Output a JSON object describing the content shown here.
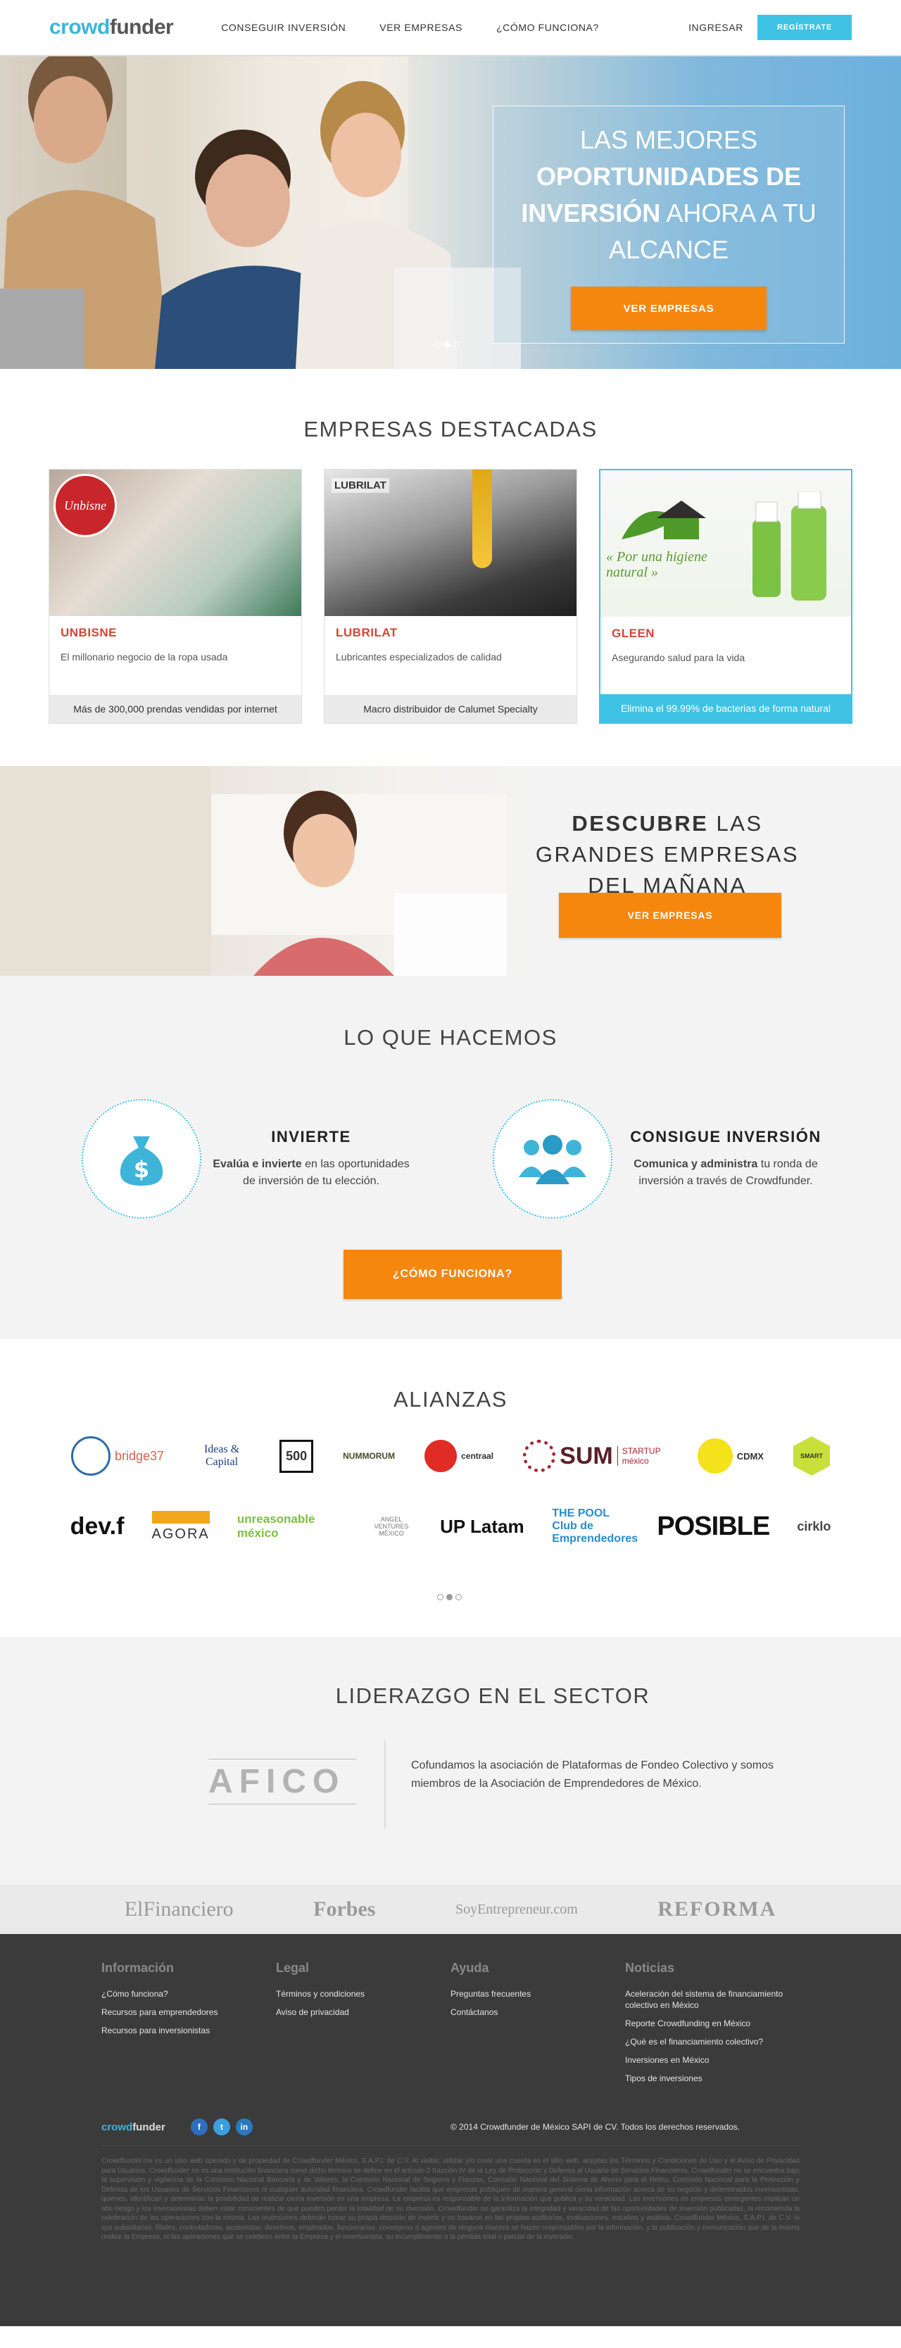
{
  "brand": {
    "logo_part1": "crowd",
    "logo_part2": "funder"
  },
  "nav": {
    "items": [
      "CONSEGUIR INVERSIÓN",
      "VER EMPRESAS",
      "¿CÓMO FUNCIONA?"
    ],
    "login": "INGRESAR",
    "register": "REGÍSTRATE"
  },
  "hero": {
    "title_line1": "LAS MEJORES",
    "title_bold": "OPORTUNIDADES DE INVERSIÓN",
    "title_rest": "AHORA A TU ALCANCE",
    "cta": "VER EMPRESAS",
    "slides": 3,
    "active_slide": 1
  },
  "featured": {
    "title": "EMPRESAS DESTACADAS",
    "cards": [
      {
        "name": "UNBISNE",
        "desc": "El millonario negocio de la ropa usada",
        "foot": "Más de 300,000 prendas vendidas por internet",
        "img_label": "Unbisne"
      },
      {
        "name": "LUBRILAT",
        "desc": "Lubricantes especializados de calidad",
        "foot": "Macro distribuidor de Calumet Specialty",
        "img_label": "LUBRILAT"
      },
      {
        "name": "GLEEN",
        "desc": "Asegurando salud para la vida",
        "foot": "Elimina el 99.99% de bacterias de forma natural",
        "img_label": "« Por una higiene natural »"
      }
    ]
  },
  "discover": {
    "bold": "DESCUBRE",
    "rest": "LAS GRANDES EMPRESAS DEL MAÑANA",
    "cta": "VER EMPRESAS"
  },
  "what": {
    "title": "LO QUE HACEMOS",
    "invest": {
      "title": "INVIERTE",
      "bold": "Evalúa e invierte",
      "text": "en las oportunidades de inversión de tu elección."
    },
    "raise": {
      "title": "CONSIGUE INVERSIÓN",
      "bold": "Comunica y administra",
      "text": "tu ronda de inversión a través de Crowdfunder."
    },
    "cta": "¿CÓMO FUNCIONA?"
  },
  "alliances": {
    "title": "ALIANZAS",
    "row1": [
      "bridge37",
      "Ideas & Capital",
      "500",
      "NUMMORUM",
      "centraal",
      "SUM",
      "STARTUP méxico",
      "CDMX",
      "SMART"
    ],
    "row2": [
      "dev.f",
      "AGORA",
      "unreasonable méxico",
      "ANGEL VENTURES MÉXICO",
      "UP Latam",
      "THE POOL Club de Emprendedores",
      "POSIBLE",
      "cirklo"
    ]
  },
  "leader": {
    "title": "LIDERAZGO EN EL SECTOR",
    "logo": "AFICO",
    "text": "Cofundamos la asociación de Plataformas de Fondeo Colectivo y somos miembros de la Asociación de Emprendedores de México."
  },
  "press": [
    "ElFinanciero",
    "Forbes",
    "SoyEntrepreneur.com",
    "REFORMA"
  ],
  "footer": {
    "cols": [
      {
        "title": "Información",
        "links": [
          "¿Cómo funciona?",
          "Recursos para emprendedores",
          "Recursos para inversionistas"
        ]
      },
      {
        "title": "Legal",
        "links": [
          "Términos y condiciones",
          "Aviso de privacidad"
        ]
      },
      {
        "title": "Ayuda",
        "links": [
          "Preguntas frecuentes",
          "Contáctanos"
        ]
      },
      {
        "title": "Noticias",
        "links": [
          "Aceleración del sistema de financiamiento colectivo en México",
          "Reporte Crowdfunding en México",
          "¿Qué es el financiamiento colectivo?",
          "Inversiones en México",
          "Tipos de inversiones"
        ]
      }
    ],
    "copyright": "© 2014 Crowdfunder de México SAPI de CV. Todos los derechos reservados.",
    "legal": "Crowdfunder.mx es un sitio web operado y de propiedad de Crowdfunder México, S.A.P.I. de C.V. Al visitar, utilizar y/o crear una cuenta en el sitio web, aceptas los Términos y Condiciones de Uso y el Aviso de Privacidad para Usuarios. Crowdfunder no es una institución financiera como dicho término se define en el artículo 2 fracción IV de la Ley de Protección y Defensa al Usuario de Servicios Financieros. Crowdfunder no se encuentra bajo la supervisión y vigilancia de la Comisión Nacional Bancaria y de Valores, la Comisión Nacional de Seguros y Fianzas, Comisión Nacional del Sistema de Ahorro para el Retiro, Comisión Nacional para la Protección y Defensa de los Usuarios de Servicios Financieros ni cualquier autoridad financiera. Crowdfunder facilita que empresas publiquen de manera general cierta información acerca de su negocio y determinados inversionistas, quienes, identifican y determinan la posibilidad de realizar cierta inversión en una empresa. La empresa es responsable de la información que publica y su veracidad. Las inversiones en empresas emergentes implican un alto riesgo y los inversionistas deben estar conscientes de que pueden perder la totalidad de su inversión. Crowdfunder no garantiza la integridad y veracidad de las oportunidades de inversión publicadas, ni recomienda la celebración de las operaciones con la misma. Las inversiones deberán tomar su propia decisión de invertir y no basarse en las propias auditorías, evaluaciones, estudios y análisis. Crowdfunder México, S.A.P.I. de C.V. ni sus subsidiarias, filiales, controladoras, accionistas, directivos, empleados, funcionarios, consejeros o agentes de ninguna manera se hacen responsables por la información, y la publicación y comunicación que de la misma realice la Empresa, ni las operaciones que se celebren entre la Empresa y el inversionista, su incumplimiento o la pérdida total o parcial de la inversión."
  }
}
